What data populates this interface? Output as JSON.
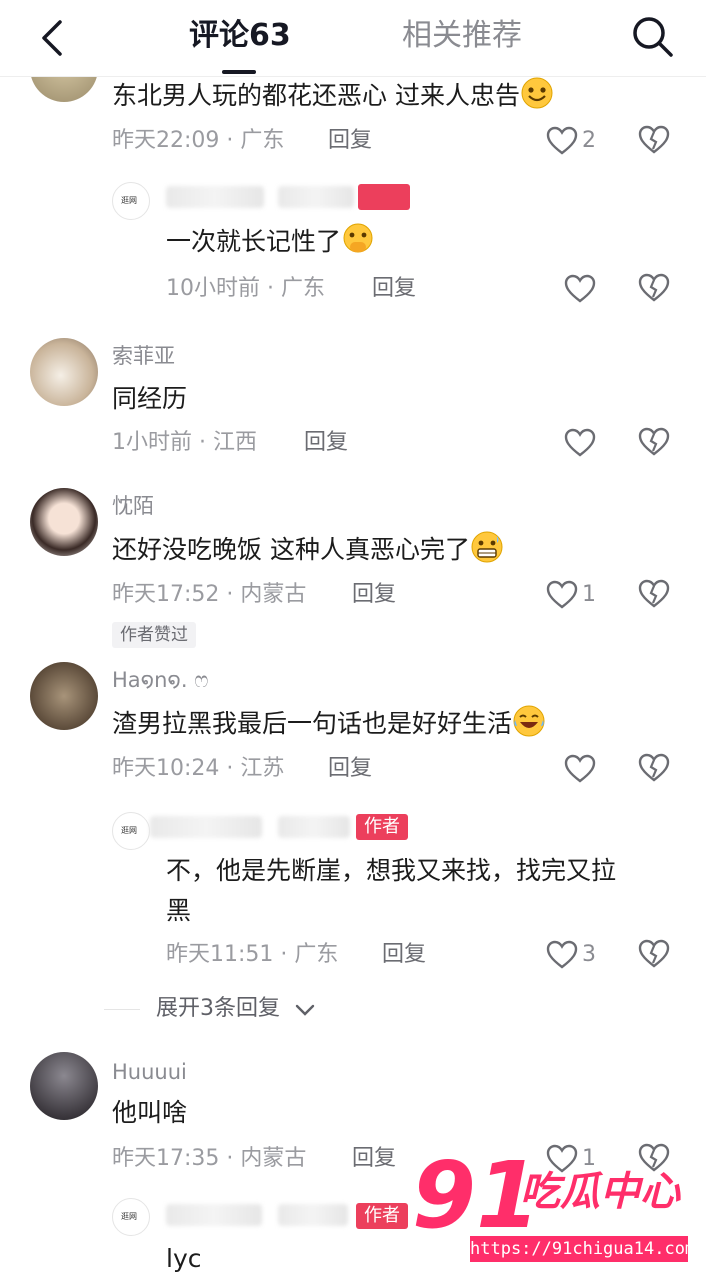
{
  "header": {
    "tab_comments": "评论63",
    "tab_related": "相关推荐",
    "back_icon": "back-arrow-icon",
    "search_icon": "search-icon"
  },
  "comments": [
    {
      "content": "东北男人玩的都花还恶心 过来人忠告",
      "time": "昨天22:09",
      "location": "广东",
      "reply": "回复",
      "likes": "2"
    },
    {
      "content": "一次就长记性了",
      "time": "10小时前",
      "location": "广东",
      "reply": "回复",
      "likes": ""
    },
    {
      "nickname": "索菲亚",
      "content": "同经历",
      "time": "1小时前",
      "location": "江西",
      "reply": "回复",
      "likes": ""
    },
    {
      "nickname": "忱陌",
      "content": "还好没吃晚饭 这种人真恶心完了",
      "time": "昨天17:52",
      "location": "内蒙古",
      "reply": "回复",
      "likes": "1",
      "tag": "作者赞过"
    },
    {
      "nickname": "Ha໑n໑. ෆ",
      "content": "渣男拉黑我最后一句话也是好好生活",
      "time": "昨天10:24",
      "location": "江苏",
      "reply": "回复",
      "likes": ""
    },
    {
      "badge": "作者",
      "content_line1": "不，他是先断崖，想我又来找，找完又拉",
      "content_line2": "黑",
      "time": "昨天11:51",
      "location": "广东",
      "reply": "回复",
      "likes": "3"
    },
    {
      "nickname": "Huuuui",
      "content": "他叫啥",
      "time": "昨天17:35",
      "location": "内蒙古",
      "reply": "回复",
      "likes": "1"
    },
    {
      "badge": "作者",
      "content": "lyc"
    }
  ],
  "expand_replies": "展开3条回复",
  "separator": "·",
  "watermark": {
    "number": "91",
    "brand": "吃瓜中心",
    "url": "https://91chigua14.com"
  },
  "colors": {
    "accent": "#ec3f5c",
    "secondary_text": "#8a8b91"
  }
}
